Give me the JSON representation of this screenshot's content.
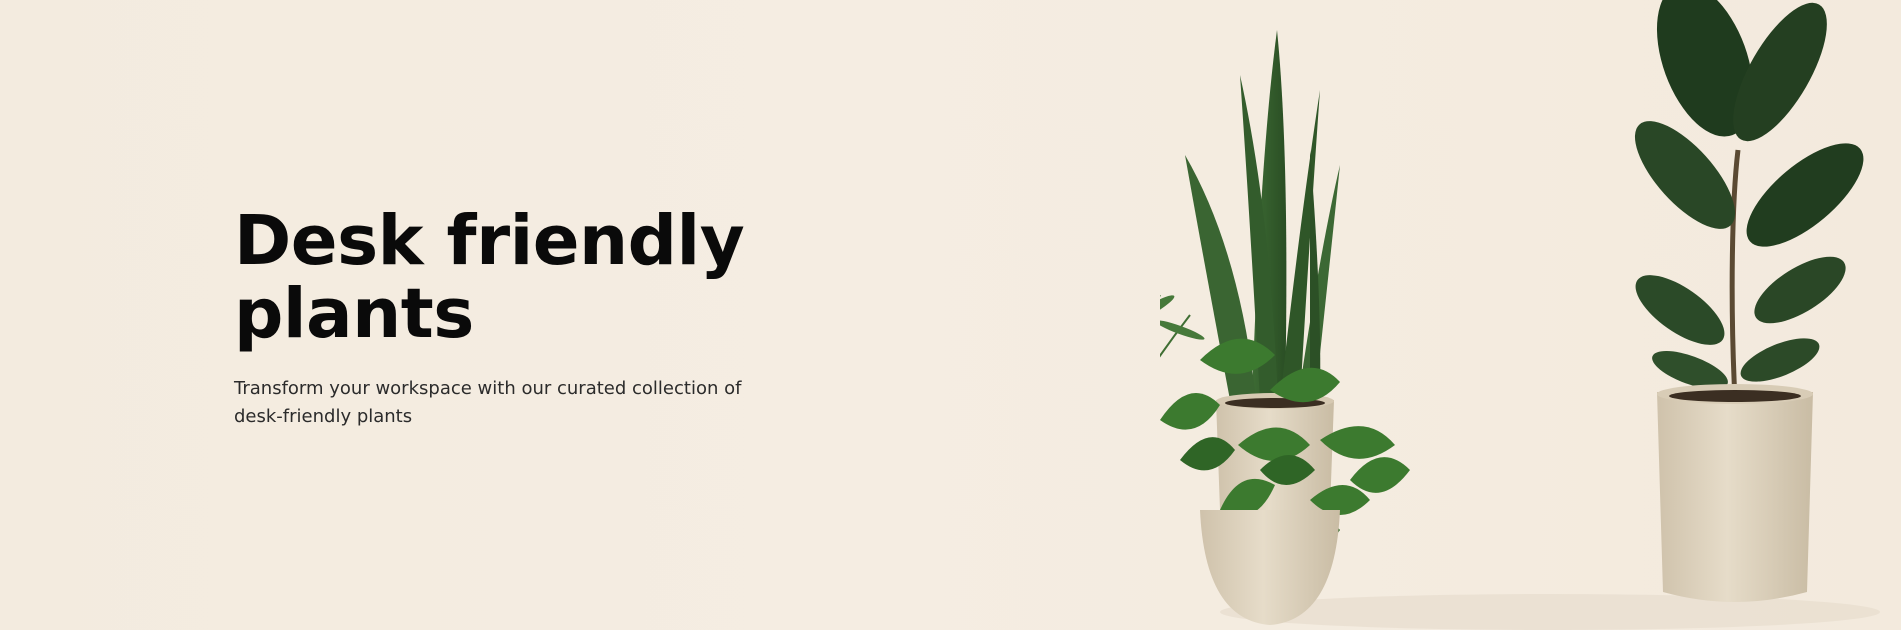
{
  "hero": {
    "title": "Desk friendly plants",
    "subtitle": "Transform your workspace with our curated collection of desk-friendly plants"
  },
  "image": {
    "subject": "potted plants",
    "colors": {
      "background": "#f4ece0",
      "leaf": "#2f5a2a",
      "leaf_dark": "#1f3a1c",
      "pot": "#d9cdb8"
    }
  }
}
